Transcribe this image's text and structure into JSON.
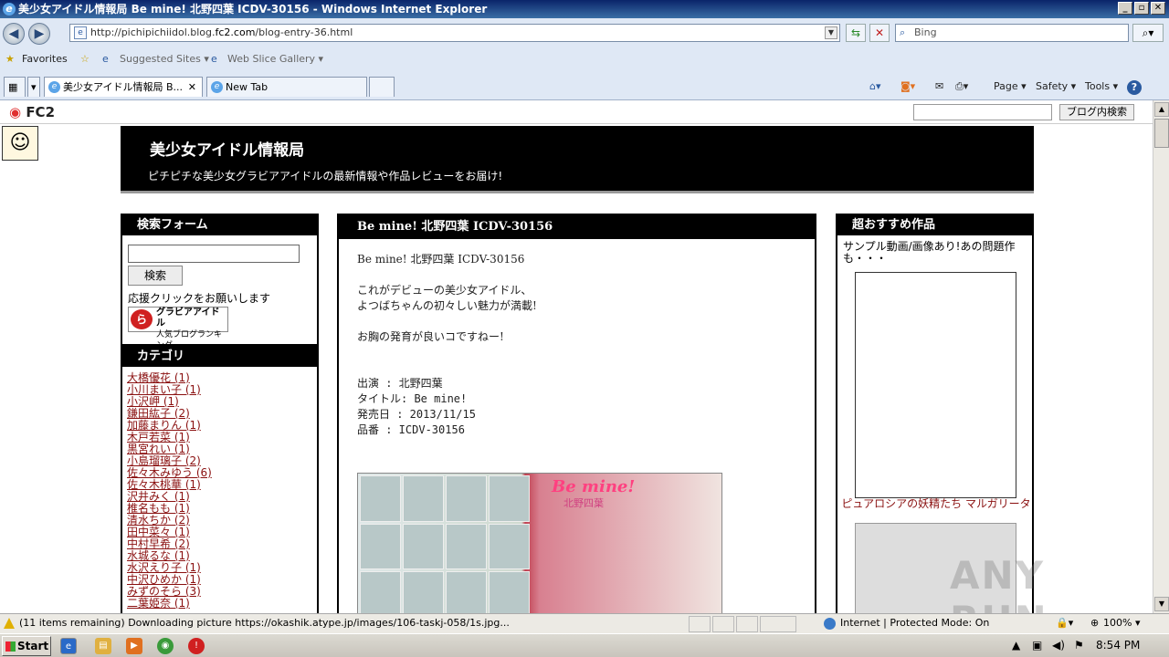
{
  "window": {
    "title": "美少女アイドル情報局 Be mine! 北野四葉 ICDV-30156 - Windows Internet Explorer",
    "minimize": "_",
    "maximize": "▫",
    "close": "✕"
  },
  "browser": {
    "url_prefix": "http://pichipichiidol.blog.",
    "url_host": "fc2.com",
    "url_path": "/blog-entry-36.html",
    "search_placeholder": "Bing",
    "favorites_label": "Favorites",
    "suggested_sites": "Suggested Sites ▾",
    "web_slice": "Web Slice Gallery ▾",
    "tabs": [
      {
        "label": "美少女アイドル情報局 B...",
        "close": "✕"
      },
      {
        "label": "New Tab"
      }
    ],
    "tools": {
      "page": "Page ▾",
      "safety": "Safety ▾",
      "tools": "Tools ▾",
      "help": "?"
    }
  },
  "fc2": {
    "logo": "FC2",
    "search_button": "ブログ内検索"
  },
  "blog": {
    "title": "美少女アイドル情報局",
    "subtitle": "ピチピチな美少女グラビアアイドルの最新情報や作品レビューをお届け!"
  },
  "sidebar_left": {
    "search_head": "検索フォーム",
    "search_button": "検索",
    "support_text": "応援クリックをお願いします",
    "banner_text_1": "グラビアアイドル",
    "banner_text_2": "人気ブログランキング",
    "category_head": "カテゴリ",
    "categories": [
      "大橋優花 (1)",
      "小川まい子 (1)",
      "小沢岬 (1)",
      "鎌田紘子 (2)",
      "加藤まりん (1)",
      "木戸若菜 (1)",
      "黒宮れい (1)",
      "小島瑠璃子 (2)",
      "佐々木みゆう (6)",
      "佐々木桃華 (1)",
      "沢井みく (1)",
      "椎名もも (1)",
      "清水ちか (2)",
      "田中菜々 (1)",
      "中村早希 (2)",
      "水城るな (1)",
      "水沢えり子 (1)",
      "中沢ひめか (1)",
      "みずのそら (3)",
      "二葉姫奈 (1)"
    ]
  },
  "post": {
    "head": "Be mine! 北野四葉  ICDV-30156",
    "line1": "Be mine! 北野四葉  ICDV-30156",
    "line2": "これがデビューの美少女アイドル、",
    "line3": "よつばちゃんの初々しい魅力が満載!",
    "line4": "お胸の発育が良いコですねー!",
    "spec1": "出演    : 北野四葉",
    "spec2": "タイトル: Be mine!",
    "spec3": "発売日  : 2013/11/15",
    "spec4": "品番    : ICDV-30156",
    "cover_title": "Be mine!",
    "cover_name": "北野四葉"
  },
  "sidebar_right": {
    "head": "超おすすめ作品",
    "text": "サンプル動画/画像あり!あの問題作も・・・",
    "link": "ピュアロシアの妖精たち  マルガリータ"
  },
  "status": {
    "text": "(11 items remaining) Downloading picture https://okashik.atype.jp/images/106-taskj-058/1s.jpg...",
    "zone": "Internet | Protected Mode: On",
    "zoom": "100% ▾"
  },
  "taskbar": {
    "start": "Start",
    "clock": "8:54 PM"
  },
  "watermark": "ANY RUN"
}
